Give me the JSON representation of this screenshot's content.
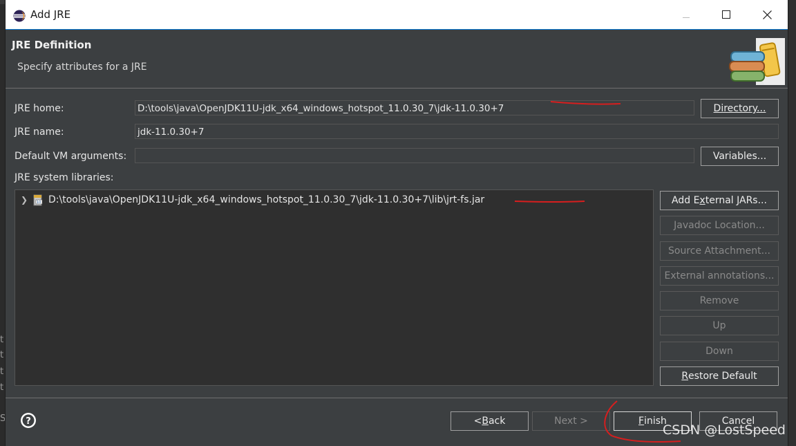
{
  "window": {
    "title": "Add JRE",
    "minimize_icon": "minimize-icon",
    "maximize_icon": "maximize-icon",
    "close_icon": "close-icon"
  },
  "header": {
    "title": "JRE Definition",
    "subtitle": "Specify attributes for a JRE",
    "icon": "jre-library-books-icon"
  },
  "form": {
    "jre_home_label": "JRE home:",
    "jre_home_value": "D:\\tools\\java\\OpenJDK11U-jdk_x64_windows_hotspot_11.0.30_7\\jdk-11.0.30+7",
    "directory_button": "Directory...",
    "jre_name_label": "JRE name:",
    "jre_name_value": "jdk-11.0.30+7",
    "vm_args_label": "Default VM arguments:",
    "vm_args_value": "",
    "variables_button": "Variables...",
    "libraries_label": "JRE system libraries:"
  },
  "libraries": [
    {
      "path": "D:\\tools\\java\\OpenJDK11U-jdk_x64_windows_hotspot_11.0.30_7\\jdk-11.0.30+7\\lib\\jrt-fs.jar",
      "icon": "jar-icon",
      "expanded": false
    }
  ],
  "side_buttons": {
    "add_external_jars": "Add External JARs...",
    "javadoc_location": "Javadoc Location...",
    "source_attachment": "Source Attachment...",
    "external_annotations": "External annotations...",
    "remove": "Remove",
    "up": "Up",
    "down": "Down",
    "restore_default": "Restore Default"
  },
  "footer": {
    "back": "< Back",
    "next": "Next >",
    "finish": "Finish",
    "cancel": "Cancel",
    "help_icon": "help-icon"
  },
  "watermark": "CSDN @LostSpeed"
}
